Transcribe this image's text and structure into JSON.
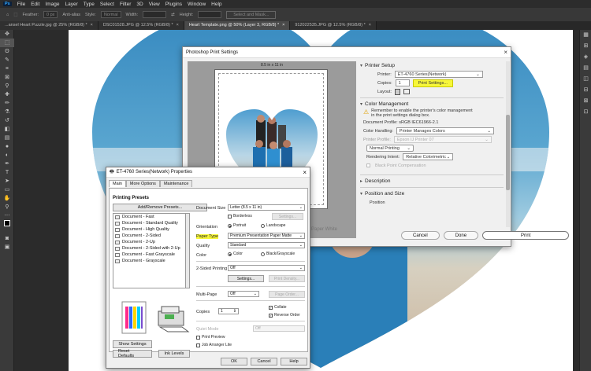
{
  "menubar": {
    "app_logo": "Ps",
    "items": [
      "File",
      "Edit",
      "Image",
      "Layer",
      "Type",
      "Select",
      "Filter",
      "3D",
      "View",
      "Plugins",
      "Window",
      "Help"
    ]
  },
  "optionsbar": {
    "feather_label": "Feather:",
    "feather_value": "0 px",
    "antialias_label": "Anti-alias",
    "style_label": "Style:",
    "style_value": "Normal",
    "width_label": "Width:",
    "height_label": "Height:",
    "select_mask_label": "Select and Mask..."
  },
  "tabs": [
    {
      "label": "...ansel Heart Puzzle.jpg @ 25% (RGB/8) *",
      "active": false
    },
    {
      "label": "DSC01528.JPG @ 12.5% (RGB/8) *",
      "active": false
    },
    {
      "label": "Heart Template.png @ 50% (Layer 3, RGB/8) *",
      "active": true
    },
    {
      "label": "912022535.JPG @ 12.5% (RGB/8) *",
      "active": false
    }
  ],
  "print_dialog": {
    "title": "Photoshop Print Settings",
    "close_glyph": "×",
    "preview_size": "8.5 in x 11 in",
    "paper_white": "Paper White",
    "printer_setup": {
      "title": "Printer Setup",
      "printer_label": "Printer:",
      "printer_value": "ET-4760 Series(Network)",
      "copies_label": "Copies:",
      "copies_value": "1",
      "print_settings_btn": "Print Settings...",
      "layout_label": "Layout:"
    },
    "color_management": {
      "title": "Color Management",
      "warning": "Remember to enable the printer's color management in the print settings dialog box.",
      "doc_profile": "Document Profile: sRGB IEC61966-2.1",
      "color_handling_label": "Color Handling:",
      "color_handling_value": "Printer Manages Colors",
      "printer_profile_label": "Printer Profile:",
      "printer_profile_value": "Epson IJ Printer 07",
      "normal_printing": "Normal Printing",
      "rendering_intent_label": "Rendering Intent:",
      "rendering_intent_value": "Relative Colorimetric",
      "black_point": "Black Point Compensation"
    },
    "description_title": "Description",
    "position_size_title": "Position and Size",
    "position_label": "Position",
    "buttons": {
      "cancel": "Cancel",
      "done": "Done",
      "print": "Print"
    }
  },
  "epson_dialog": {
    "title": "ET-4760 Series(Network) Properties",
    "close_glyph": "×",
    "tabs": [
      "Main",
      "More Options",
      "Maintenance"
    ],
    "presets_title": "Printing Presets",
    "add_remove": "Add/Remove Presets...",
    "presets": [
      "Document - Fast",
      "Document - Standard Quality",
      "Document - High Quality",
      "Document - 2-Sided",
      "Document - 2-Up",
      "Document - 2-Sided with 2-Up",
      "Document - Fast Grayscale",
      "Document - Grayscale"
    ],
    "document_size_label": "Document Size",
    "document_size_value": "Letter (8.5 x 11 in)",
    "borderless": "Borderless",
    "settings_btn": "Settings...",
    "orientation_label": "Orientation",
    "portrait": "Portrait",
    "landscape": "Landscape",
    "paper_type_label": "Paper Type",
    "paper_type_value": "Premium Presentation Paper Matte",
    "quality_label": "Quality",
    "quality_value": "Standard",
    "color_label": "Color",
    "color_opt": "Color",
    "bw_opt": "Black/Grayscale",
    "two_sided_label": "2-Sided Printing",
    "two_sided_value": "Off",
    "settings2_btn": "Settings...",
    "print_density_btn": "Print Density...",
    "multipage_label": "Multi-Page",
    "multipage_value": "Off",
    "page_order_btn": "Page Order...",
    "copies_label": "Copies",
    "copies_value": "1",
    "collate": "Collate",
    "reverse_order": "Reverse Order",
    "quiet_mode_label": "Quiet Mode",
    "quiet_mode_value": "Off",
    "print_preview": "Print Preview",
    "job_arranger": "Job Arranger Lite",
    "show_settings": "Show Settings",
    "reset_defaults": "Reset Defaults",
    "ink_levels": "Ink Levels",
    "ok": "OK",
    "cancel": "Cancel",
    "help": "Help"
  }
}
